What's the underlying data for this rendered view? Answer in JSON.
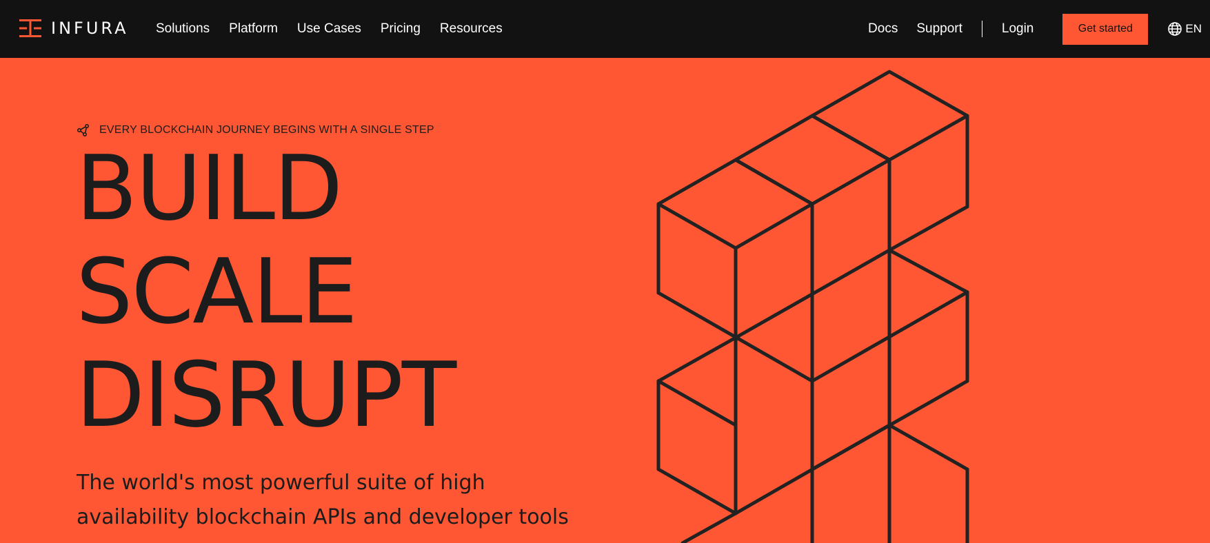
{
  "brand": {
    "name": "INFURA"
  },
  "nav": {
    "primary": [
      {
        "label": "Solutions"
      },
      {
        "label": "Platform"
      },
      {
        "label": "Use Cases"
      },
      {
        "label": "Pricing"
      },
      {
        "label": "Resources"
      }
    ],
    "docs": "Docs",
    "support": "Support",
    "login": "Login",
    "cta": "Get started",
    "language": "EN"
  },
  "hero": {
    "eyebrow": "EVERY BLOCKCHAIN JOURNEY BEGINS WITH A SINGLE STEP",
    "headline": [
      "BUILD",
      "SCALE",
      "DISRUPT"
    ],
    "subhead": [
      "The world's most powerful suite of high",
      "availability blockchain APIs and developer tools"
    ]
  },
  "colors": {
    "accent": "#FF5733",
    "nav_background": "#121212",
    "ink": "#1c1c1c"
  },
  "icons": {
    "logo": "infura-logo-icon",
    "eyebrow": "network-nodes-icon",
    "language": "globe-icon"
  }
}
